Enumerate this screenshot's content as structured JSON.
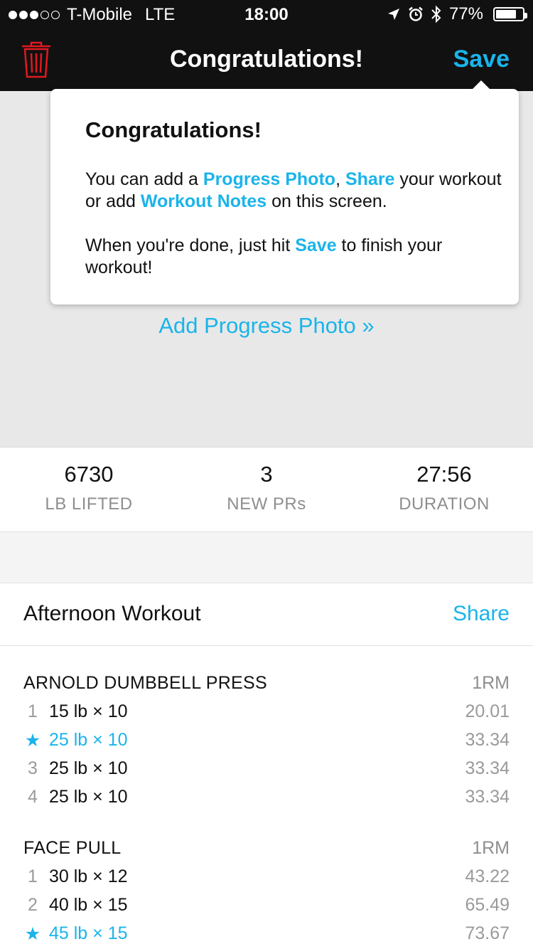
{
  "status_bar": {
    "carrier": "T-Mobile",
    "network": "LTE",
    "time": "18:00",
    "battery": "77%",
    "battery_level": 0.77,
    "icons": [
      "location-arrow-icon",
      "alarm-icon",
      "bluetooth-icon"
    ]
  },
  "nav": {
    "title": "Congratulations!",
    "save_label": "Save",
    "delete_icon": "trash-icon"
  },
  "popover": {
    "title": "Congratulations!",
    "p1_a": "You can add a ",
    "p1_link1": "Progress Photo",
    "p1_b": ", ",
    "p1_link2": "Share",
    "p1_c": " your workout or add ",
    "p1_link3": "Workout Notes",
    "p1_d": " on this screen.",
    "p2_a": "When you're done, just hit ",
    "p2_link": "Save",
    "p2_b": " to finish your workout!"
  },
  "hero": {
    "add_photo": "Add Progress Photo »"
  },
  "stats": [
    {
      "value": "6730",
      "label": "LB LIFTED"
    },
    {
      "value": "3",
      "label": "NEW PRs"
    },
    {
      "value": "27:56",
      "label": "DURATION"
    }
  ],
  "workout": {
    "title": "Afternoon Workout",
    "share_label": "Share"
  },
  "exercises": [
    {
      "name": "ARNOLD DUMBBELL PRESS",
      "col_label": "1RM",
      "sets": [
        {
          "num": "1",
          "value": "15 lb × 10",
          "one_rm": "20.01",
          "pr": false
        },
        {
          "num": "★",
          "value": "25 lb × 10",
          "one_rm": "33.34",
          "pr": true
        },
        {
          "num": "3",
          "value": "25 lb × 10",
          "one_rm": "33.34",
          "pr": false
        },
        {
          "num": "4",
          "value": "25 lb × 10",
          "one_rm": "33.34",
          "pr": false
        }
      ]
    },
    {
      "name": "FACE PULL",
      "col_label": "1RM",
      "sets": [
        {
          "num": "1",
          "value": "30 lb × 12",
          "one_rm": "43.22",
          "pr": false
        },
        {
          "num": "2",
          "value": "40 lb × 15",
          "one_rm": "65.49",
          "pr": false
        },
        {
          "num": "★",
          "value": "45 lb × 15",
          "one_rm": "73.67",
          "pr": true
        }
      ]
    }
  ],
  "colors": {
    "accent": "#1ab4ea",
    "nav_bg": "#111111",
    "delete": "#e0191f"
  }
}
